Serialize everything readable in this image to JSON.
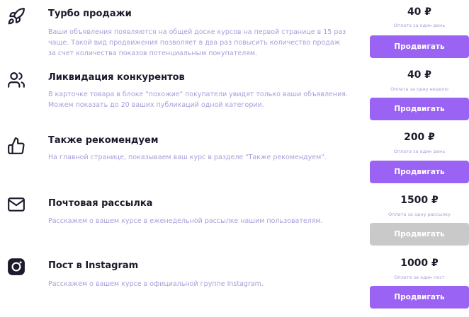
{
  "theme": {
    "accent": "#9a63f4",
    "disabled": "#c9c9c9",
    "muted_text": "#a69fd9",
    "title_text": "#1c1a2b"
  },
  "services": [
    {
      "icon": "rocket-icon",
      "title": "Турбо продажи",
      "description": "Ваши объявления появляются на общей доске курсов на первой странице в 15 раз чаще. Такой вид продвижения позволяет в два раз повысить количество продаж за счет количества показов потенциальным покупателям.",
      "price": "40 ₽",
      "price_note": "Оплата за один день",
      "button_label": "Продвигать",
      "button_enabled": true
    },
    {
      "icon": "users-icon",
      "title": "Ликвидация конкурентов",
      "description": "В карточке товара в блоке \"похожие\" покупатели увидят только ваши объявления. Можем показать до 20 ваших публикаций одной категории.",
      "price": "40 ₽",
      "price_note": "Оплата за одну неделю",
      "button_label": "Продвигать",
      "button_enabled": true
    },
    {
      "icon": "thumbs-up-icon",
      "title": "Также рекомендуем",
      "description": "На главной странице, показываем ваш курс в разделе \"Также рекомендуем\".",
      "price": "200 ₽",
      "price_note": "Оплата за один день",
      "button_label": "Продвигать",
      "button_enabled": true
    },
    {
      "icon": "mail-icon",
      "title": "Почтовая рассылка",
      "description": "Расскажем о вашем курсе в еженедельной рассылке нашим пользователям.",
      "price": "1500 ₽",
      "price_note": "Оплата за одну рассылку",
      "button_label": "Продвигать",
      "button_enabled": false
    },
    {
      "icon": "instagram-icon",
      "title": "Пост в Instagram",
      "description": "Расскажем о вашем курсе в официальной группе Instagram.",
      "price": "1000 ₽",
      "price_note": "Оплата за один пост",
      "button_label": "Продвигать",
      "button_enabled": true
    }
  ]
}
